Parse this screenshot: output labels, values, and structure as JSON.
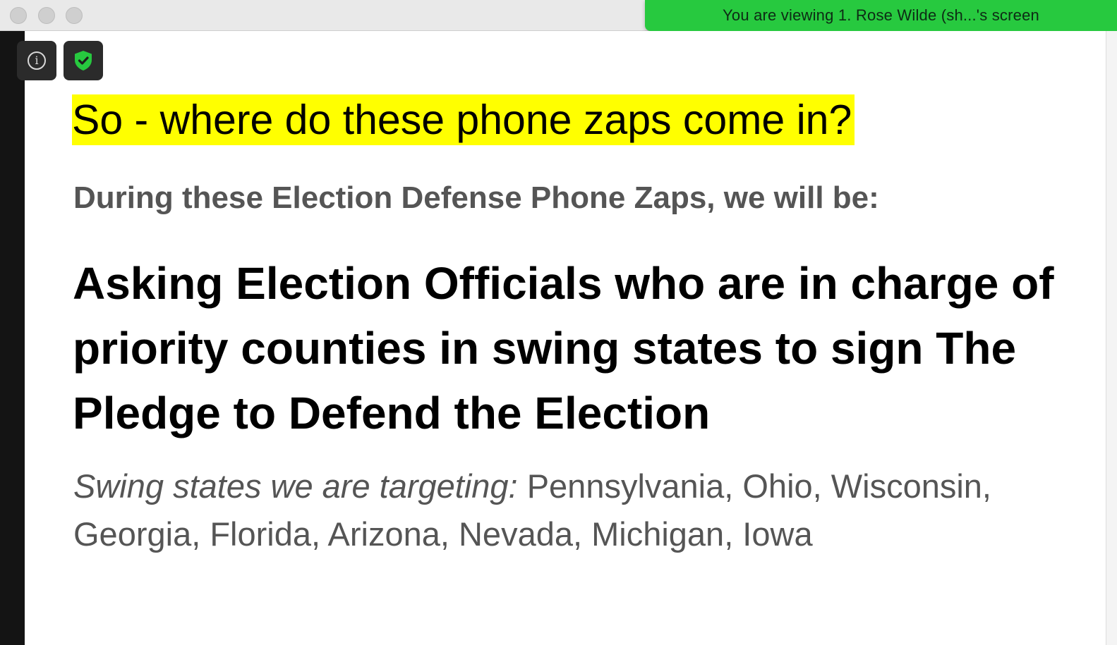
{
  "window": {
    "share_banner": "You are viewing 1. Rose Wilde (sh...'s screen"
  },
  "toolbar": {
    "info_icon": "info-icon",
    "security_icon": "shield-check-icon",
    "security_color": "#27c93f"
  },
  "slide": {
    "headline": "So - where do these phone zaps come in?",
    "headline_highlight": "#ffff00",
    "subheading": "During these Election Defense Phone Zaps, we will be:",
    "main_statement": "Asking Election Officials who are in charge of priority counties in swing states to sign The Pledge to Defend the Election",
    "states_label": "Swing states we are targeting:",
    "states_list": "Pennsylvania, Ohio, Wisconsin, Georgia, Florida, Arizona, Nevada, Michigan, Iowa"
  }
}
